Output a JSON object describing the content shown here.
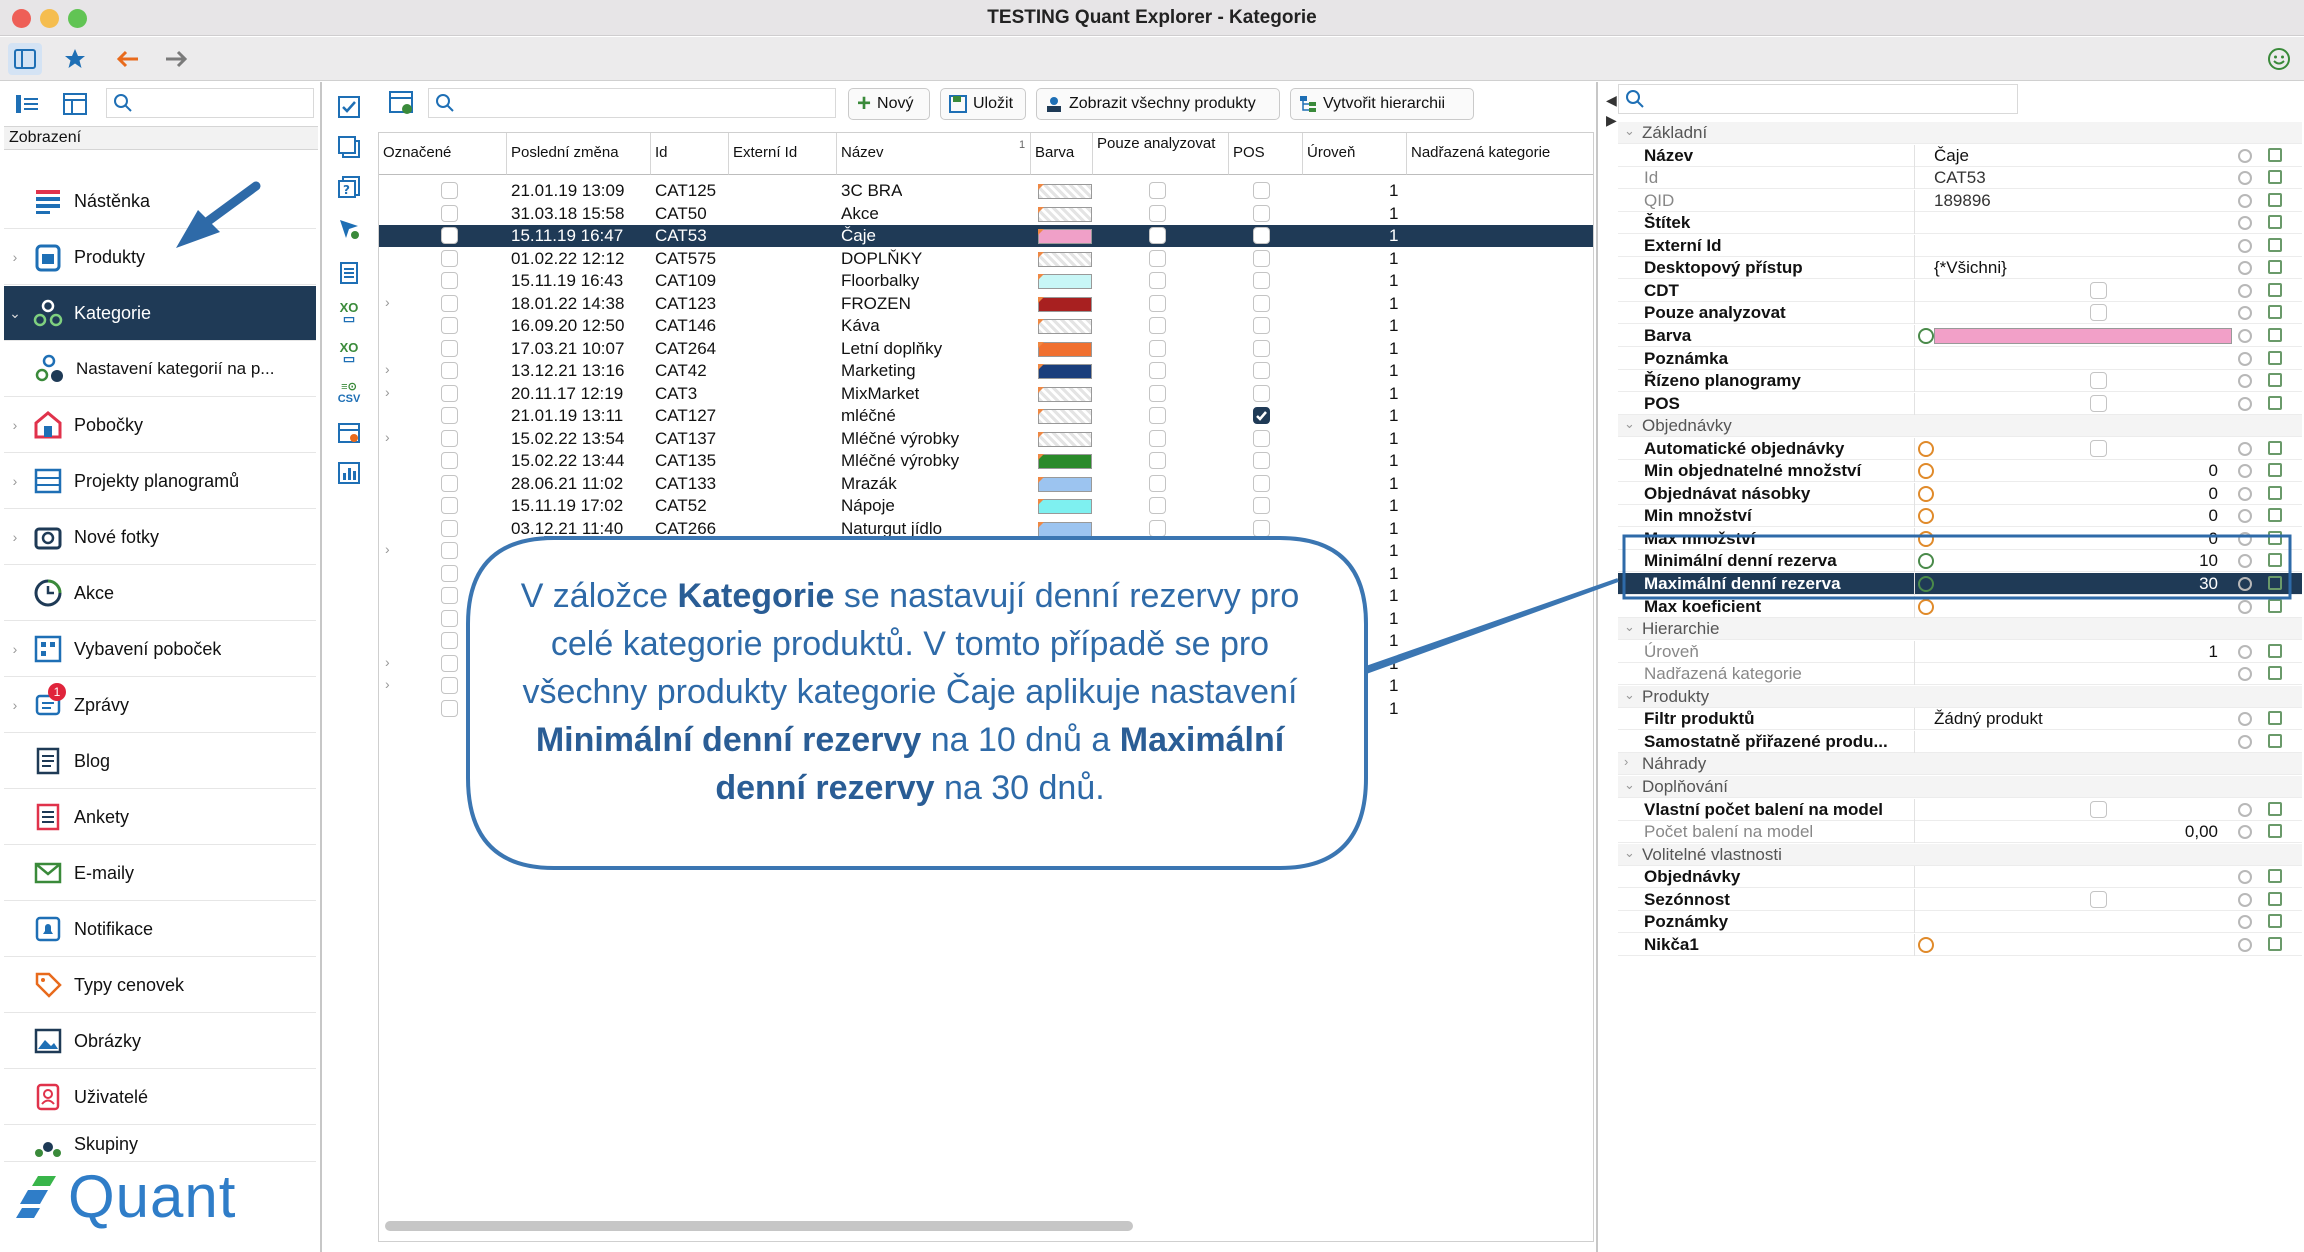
{
  "window": {
    "title": "TESTING Quant Explorer - Kategorie"
  },
  "sidebar": {
    "header": "Zobrazení",
    "items": [
      {
        "label": "Nástěnka",
        "icon": "dashboard-icon"
      },
      {
        "label": "Produkty",
        "icon": "product-icon"
      },
      {
        "label": "Kategorie",
        "icon": "category-icon"
      },
      {
        "label": "Nastavení kategorií na p...",
        "icon": "category-settings-icon"
      },
      {
        "label": "Pobočky",
        "icon": "store-icon"
      },
      {
        "label": "Projekty planogramů",
        "icon": "planogram-icon"
      },
      {
        "label": "Nové fotky",
        "icon": "camera-icon"
      },
      {
        "label": "Akce",
        "icon": "clock-icon"
      },
      {
        "label": "Vybavení poboček",
        "icon": "equipment-icon"
      },
      {
        "label": "Zprávy",
        "icon": "message-icon",
        "badge": "1"
      },
      {
        "label": "Blog",
        "icon": "blog-icon"
      },
      {
        "label": "Ankety",
        "icon": "survey-icon"
      },
      {
        "label": "E-maily",
        "icon": "email-icon"
      },
      {
        "label": "Notifikace",
        "icon": "notification-icon"
      },
      {
        "label": "Typy cenovek",
        "icon": "price-tag-icon"
      },
      {
        "label": "Obrázky",
        "icon": "image-icon"
      },
      {
        "label": "Uživatelé",
        "icon": "user-icon"
      },
      {
        "label": "Skupiny",
        "icon": "group-icon"
      }
    ]
  },
  "toolbar": {
    "new": "Nový",
    "save": "Uložit",
    "show_all": "Zobrazit všechny produkty",
    "create_hierarchy": "Vytvořit hierarchii"
  },
  "icon_strip": {
    "xo": "XO",
    "csv": "CSV"
  },
  "grid": {
    "columns": [
      "Označené",
      "Poslední změna",
      "Id",
      "Externí Id",
      "Název",
      "Barva",
      "Pouze analyzovat",
      "POS",
      "Úroveň",
      "Nadřazená kategorie"
    ],
    "rows": [
      {
        "date": "21.01.19 13:09",
        "id": "CAT125",
        "name": "3C BRA",
        "level": "1",
        "color": "#ffffff",
        "pos": false
      },
      {
        "date": "31.03.18 15:58",
        "id": "CAT50",
        "name": "Akce",
        "level": "1",
        "color": "#ffffff",
        "pos": false
      },
      {
        "date": "15.11.19 16:47",
        "id": "CAT53",
        "name": "Čaje",
        "level": "1",
        "color": "#f0a0c8",
        "pos": false
      },
      {
        "date": "01.02.22 12:12",
        "id": "CAT575",
        "name": "DOPLŇKY",
        "level": "1",
        "color": "#ffffff",
        "pos": false
      },
      {
        "date": "15.11.19 16:43",
        "id": "CAT109",
        "name": "Floorbalky",
        "level": "1",
        "color": "#c8f6f6",
        "pos": false
      },
      {
        "date": "18.01.22 14:38",
        "id": "CAT123",
        "name": "FROZEN",
        "level": "1",
        "color": "#a82020",
        "pos": false
      },
      {
        "date": "16.09.20 12:50",
        "id": "CAT146",
        "name": "Káva",
        "level": "1",
        "color": "#ffffff",
        "pos": false
      },
      {
        "date": "17.03.21 10:07",
        "id": "CAT264",
        "name": "Letní doplňky",
        "level": "1",
        "color": "#f07030",
        "pos": false
      },
      {
        "date": "13.12.21 13:16",
        "id": "CAT42",
        "name": "Marketing",
        "level": "1",
        "color": "#1a3e7c",
        "pos": false
      },
      {
        "date": "20.11.17 12:19",
        "id": "CAT3",
        "name": "MixMarket",
        "level": "1",
        "color": "#ffffff",
        "pos": false
      },
      {
        "date": "21.01.19 13:11",
        "id": "CAT127",
        "name": "mléčné",
        "level": "1",
        "color": "#ffffff",
        "pos": true
      },
      {
        "date": "15.02.22 13:54",
        "id": "CAT137",
        "name": "Mléčné výrobky",
        "level": "1",
        "color": "#ffffff",
        "pos": false
      },
      {
        "date": "15.02.22 13:44",
        "id": "CAT135",
        "name": "Mléčné výrobky",
        "level": "1",
        "color": "#2a8a2a",
        "pos": false
      },
      {
        "date": "28.06.21 11:02",
        "id": "CAT133",
        "name": "Mrazák",
        "level": "1",
        "color": "#9cc4f0",
        "pos": false
      },
      {
        "date": "15.11.19 17:02",
        "id": "CAT52",
        "name": "Nápoje",
        "level": "1",
        "color": "#7ef0f0",
        "pos": false
      },
      {
        "date": "03.12.21 11:40",
        "id": "CAT266",
        "name": "Naturgut jídlo",
        "level": "1",
        "color": "#9cc4f0",
        "pos": false
      }
    ],
    "hidden_row_levels": [
      "1",
      "1",
      "1",
      "1",
      "1",
      "1",
      "1",
      "1"
    ]
  },
  "properties": [
    {
      "type": "group",
      "label": "Základní"
    },
    {
      "label": "Název",
      "value": "Čaje"
    },
    {
      "label": "Id",
      "value": "CAT53",
      "disabled": true
    },
    {
      "label": "QID",
      "value": "189896",
      "disabled": true
    },
    {
      "label": "Štítek",
      "value": ""
    },
    {
      "label": "Externí Id",
      "value": ""
    },
    {
      "label": "Desktopový přístup",
      "value": "{*Všichni}"
    },
    {
      "label": "CDT",
      "checkbox": true
    },
    {
      "label": "Pouze analyzovat",
      "checkbox": true
    },
    {
      "label": "Barva",
      "color": "#f2a0c8",
      "gicon": true
    },
    {
      "label": "Poznámka",
      "value": ""
    },
    {
      "label": "Řízeno planogramy",
      "checkbox": true
    },
    {
      "label": "POS",
      "checkbox": true
    },
    {
      "type": "group",
      "label": "Objednávky"
    },
    {
      "label": "Automatické objednávky",
      "checkbox": true,
      "oicon": true
    },
    {
      "label": "Min objednatelné množství",
      "num": "0",
      "oicon": true
    },
    {
      "label": "Objednávat násobky",
      "num": "0",
      "oicon": true
    },
    {
      "label": "Min množství",
      "num": "0",
      "oicon": true
    },
    {
      "label": "Max množství",
      "num": "0",
      "oicon": true
    },
    {
      "label": "Minimální denní rezerva",
      "num": "10",
      "gicon": true
    },
    {
      "label": "Maximální denní rezerva",
      "num": "30",
      "gicon": true,
      "highlight": true
    },
    {
      "label": "Max koeficient",
      "value": "",
      "oicon": true
    },
    {
      "type": "group",
      "label": "Hierarchie"
    },
    {
      "label": "Úroveň",
      "num": "1",
      "disabled": true
    },
    {
      "label": "Nadřazená kategorie",
      "value": "",
      "disabled": true
    },
    {
      "type": "group",
      "label": "Produkty"
    },
    {
      "label": "Filtr produktů",
      "value": "Žádný produkt"
    },
    {
      "label": "Samostatně přiřazené produ...",
      "value": ""
    },
    {
      "type": "group",
      "label": "Náhrady",
      "collapsed": true
    },
    {
      "type": "group",
      "label": "Doplňování"
    },
    {
      "label": "Vlastní počet balení na model",
      "checkbox": true
    },
    {
      "label": "Počet balení na model",
      "num": "0,00",
      "disabled": true
    },
    {
      "type": "group",
      "label": "Volitelné vlastnosti"
    },
    {
      "label": "Objednávky",
      "value": ""
    },
    {
      "label": "Sezónnost",
      "checkbox": true
    },
    {
      "label": "Poznámky",
      "value": ""
    },
    {
      "label": "Nikča1",
      "value": "",
      "oicon": true
    }
  ],
  "callout": {
    "t1": "V záložce ",
    "b1": "Kategorie",
    "t2": " se nastavují denní rezervy pro celé kategorie produktů. V tomto případě se pro všechny produkty kategorie Čaje aplikuje nastavení ",
    "b2": "Minimální denní rezervy",
    "t3": " na 10 dnů a ",
    "b3": "Maximální denní rezervy",
    "t4": " na 30 dnů."
  },
  "logo": {
    "text": "Quant"
  },
  "colors": {
    "selection": "#1f3a56",
    "accent": "#1e6fb5",
    "callout": "#3b76b2",
    "orange": "#e08a2a"
  }
}
